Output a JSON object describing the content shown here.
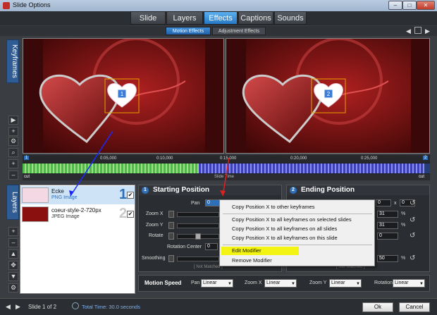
{
  "window": {
    "title": "Slide Options"
  },
  "tabs": [
    {
      "label": "Slide"
    },
    {
      "label": "Layers"
    },
    {
      "label": "Effects"
    },
    {
      "label": "Captions"
    },
    {
      "label": "Sounds"
    }
  ],
  "subtabs": [
    {
      "label": "Motion Effects"
    },
    {
      "label": "Adjustment Effects"
    }
  ],
  "side": {
    "keyframes": "Keyframes",
    "layers": "Layers"
  },
  "timeline": {
    "ticks": [
      "0:05,000",
      "0:10,000",
      "0:15,000",
      "0:20,000",
      "0:25,000"
    ],
    "left_marker": "1",
    "right_marker": "2",
    "cut_left": "cut",
    "cut_right": "cut",
    "slide_time": "Slide Time"
  },
  "layers": [
    {
      "name": "Ecke",
      "type": "PNG Image",
      "number": "1",
      "checked": "✔"
    },
    {
      "name": "coeur-style-2-720px",
      "type": "JPEG Image",
      "number": "2",
      "checked": "✔"
    }
  ],
  "start": {
    "index": "1",
    "title": "Starting Position",
    "pan_label": "Pan",
    "pan_value": "0",
    "zoomx": "Zoom X",
    "zoomy": "Zoom Y",
    "rotate": "Rotate",
    "rotation_center": "Rotation Center",
    "rc_value": "0",
    "smoothing": "Smoothing",
    "not_matched": "[ Not Matched ]"
  },
  "end": {
    "index": "2",
    "title": "Ending Position",
    "pan_value": "0",
    "zoomx_value": "31",
    "zoomy_value": "31",
    "rotate_value": "0",
    "smooth_value": "50",
    "pct": "%",
    "x_label": "x",
    "not_matched": "[ Not Matched ]"
  },
  "context_menu": {
    "items": [
      {
        "label": "Copy Position X to other keyframes"
      },
      {
        "label": "Copy Position X to all keyframes on selected slides"
      },
      {
        "label": "Copy Position X to all keyframes on all slides"
      },
      {
        "label": "Copy Position X to all keyframes on this slide"
      },
      {
        "label": "Edit Modifier"
      },
      {
        "label": "Remove Modifier"
      }
    ]
  },
  "motion_speed": {
    "label": "Motion Speed",
    "pan_label": "Pan",
    "pan_value": "Linear",
    "zoomx_label": "Zoom X",
    "zoomx_value": "Linear",
    "zoomy_label": "Zoom Y",
    "zoomy_value": "Linear",
    "rotation_label": "Rotation",
    "rotation_value": "Linear"
  },
  "footer": {
    "slide_info": "Slide 1 of 2",
    "total_time": "Total Time: 30.0 seconds",
    "ok": "Ok",
    "cancel": "Cancel"
  },
  "keyframe_badge": "1",
  "keyframe_badge2": "2",
  "colors": {
    "accent": "#2778c4",
    "highlight": "#f4f414",
    "panel": "#2a2d31"
  }
}
